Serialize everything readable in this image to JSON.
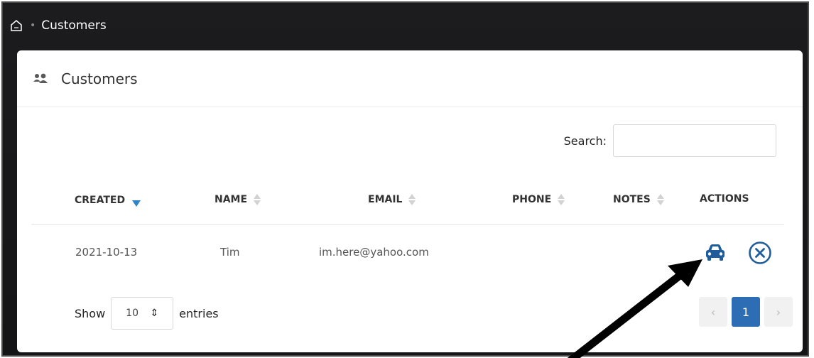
{
  "breadcrumb": {
    "current": "Customers"
  },
  "card": {
    "title": "Customers"
  },
  "search": {
    "label": "Search:",
    "value": "",
    "placeholder": ""
  },
  "table": {
    "columns": [
      "CREATED",
      "NAME",
      "EMAIL",
      "PHONE",
      "NOTES",
      "ACTIONS"
    ],
    "rows": [
      {
        "created": "2021-10-13",
        "name": "Tim",
        "email": "im.here@yahoo.com",
        "phone": "",
        "notes": ""
      }
    ]
  },
  "footer": {
    "show_label": "Show",
    "page_length": "10",
    "entries_label": "entries"
  },
  "pagination": {
    "prev": "‹",
    "current": "1",
    "next": "›"
  },
  "colors": {
    "accent": "#2c6db3",
    "sort_active": "#2c82c9",
    "car_icon": "#1f5c9c"
  }
}
